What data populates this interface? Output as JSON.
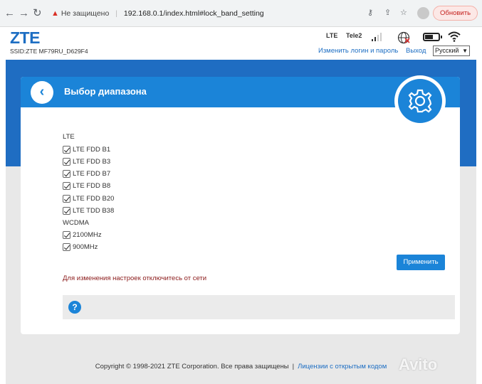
{
  "browser": {
    "back": "←",
    "forward": "→",
    "reload": "↻",
    "security_label": "Не защищено",
    "url": "192.168.0.1/index.html#lock_band_setting",
    "update_label": "Обновить"
  },
  "header": {
    "logo": "ZTE",
    "ssid": "SSID:ZTE MF79RU_D629F4",
    "network_type": "LTE",
    "operator": "Tele2",
    "battery_level": 0.6,
    "change_login_label": "Изменить логин и пароль",
    "logout_label": "Выход",
    "language": "Русский"
  },
  "card": {
    "title": "Выбор диапазона",
    "back_symbol": "‹",
    "groups": [
      {
        "label": "LTE",
        "bands": [
          {
            "label": "LTE FDD B1",
            "checked": true
          },
          {
            "label": "LTE FDD B3",
            "checked": true
          },
          {
            "label": "LTE FDD B7",
            "checked": true
          },
          {
            "label": "LTE FDD B8",
            "checked": true
          },
          {
            "label": "LTE FDD B20",
            "checked": true
          },
          {
            "label": "LTE TDD B38",
            "checked": true
          }
        ]
      },
      {
        "label": "WCDMA",
        "bands": [
          {
            "label": "2100MHz",
            "checked": true
          },
          {
            "label": "900MHz",
            "checked": true
          }
        ]
      }
    ],
    "apply_label": "Применить",
    "notice": "Для изменения настроек отключитесь от сети",
    "help_symbol": "?"
  },
  "footer": {
    "copyright": "Copyright © 1998-2021 ZTE Corporation. Все права защищены",
    "divider": "|",
    "open_source": "Лицензии с открытым кодом"
  },
  "watermark": "Avito",
  "colors": {
    "brand_blue": "#1d6ec3",
    "header_blue": "#1b84d8",
    "notice_red": "#8b1a1a"
  }
}
